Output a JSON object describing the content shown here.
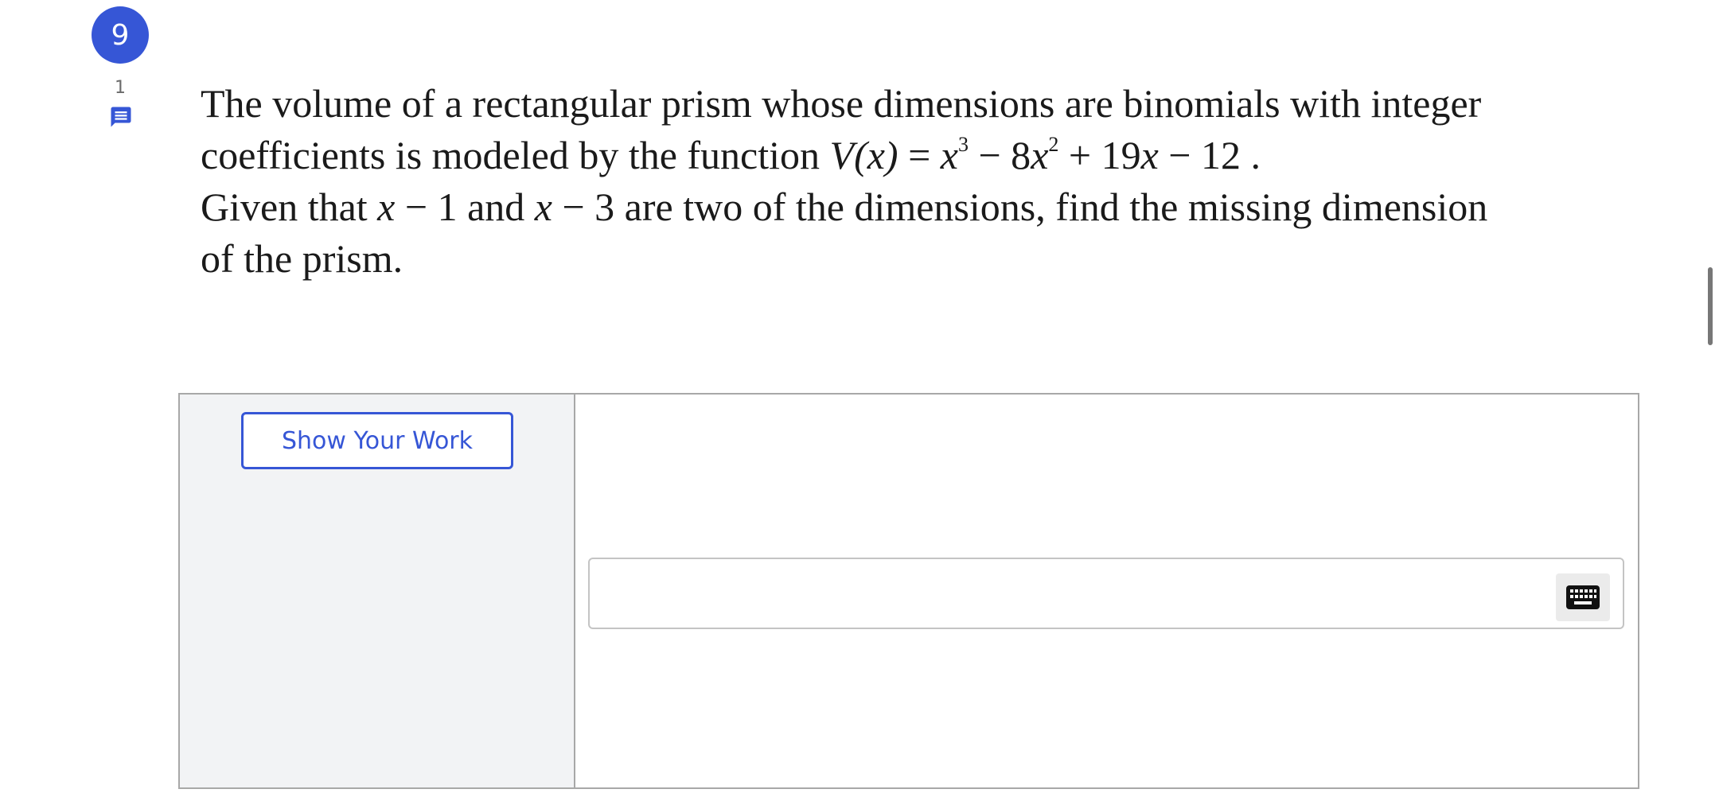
{
  "question": {
    "number": "9",
    "comment_count": "1",
    "line1": "The volume of a rectangular prism whose dimensions are binomials with integer",
    "line2_prefix": "coefficients is modeled by the function ",
    "func_V": "V",
    "func_arg": "(x)",
    "eq": " = ",
    "x1": "x",
    "exp3": "3",
    "minus8": " − 8",
    "x2": "x",
    "exp2": "2",
    "plus19": " + 19",
    "x3": "x",
    "minus12": " − 12 .",
    "line3_a": "Given that ",
    "line3_x1": "x",
    "line3_b": " − 1 and ",
    "line3_x2": "x",
    "line3_c": " − 3 are two of the dimensions, find the missing dimension",
    "line4": "of the prism."
  },
  "work": {
    "show_work_label": "Show Your Work",
    "answer_value": "",
    "answer_placeholder": ""
  },
  "icons": {
    "comment": "comment-icon",
    "keyboard": "keyboard-icon"
  },
  "colors": {
    "accent": "#3656d6",
    "panel_bg": "#f2f3f5",
    "border": "#a8a8a8"
  }
}
